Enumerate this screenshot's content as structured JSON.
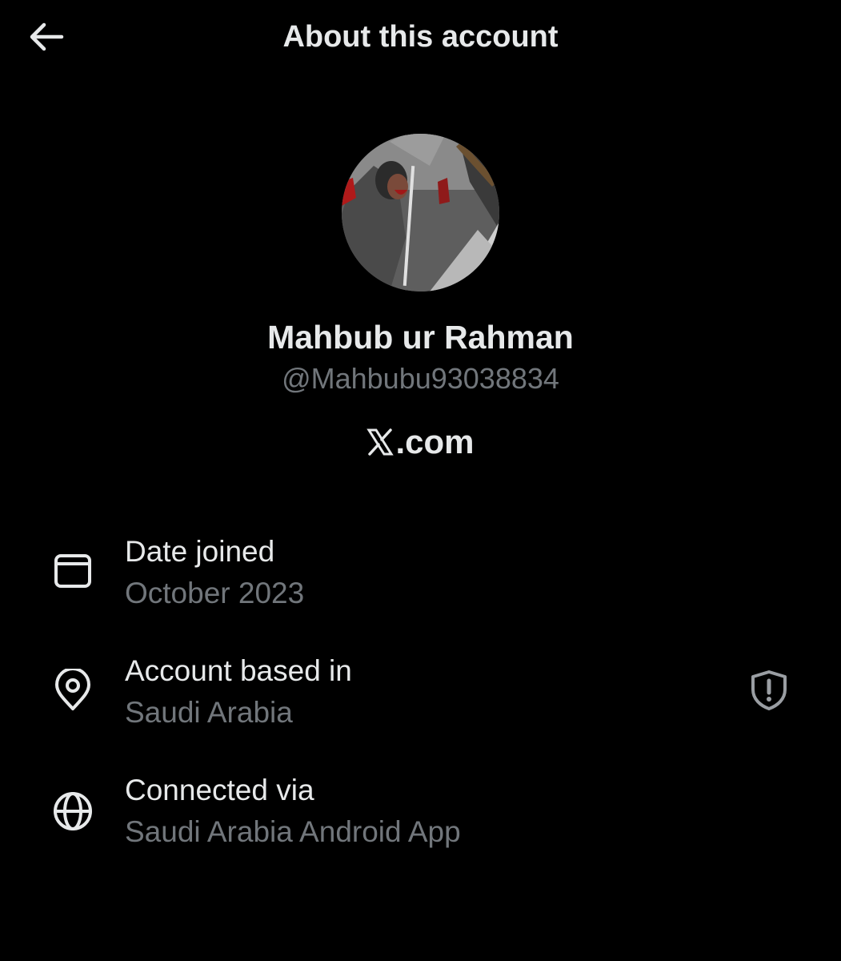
{
  "header": {
    "title": "About this account",
    "back_icon": "arrow-left-icon"
  },
  "profile": {
    "display_name": "Mahbub ur Rahman",
    "handle": "@Mahbubu93038834",
    "avatar_icon": "profile-photo"
  },
  "platform": {
    "logo_icon": "x-logo-icon",
    "label": ".com"
  },
  "rows": [
    {
      "icon": "calendar-icon",
      "label": "Date joined",
      "value": "October 2023"
    },
    {
      "icon": "location-pin-icon",
      "label": "Account based in",
      "value": "Saudi Arabia",
      "badge_icon": "shield-alert-icon"
    },
    {
      "icon": "globe-icon",
      "label": "Connected via",
      "value": "Saudi Arabia Android App"
    }
  ],
  "colors": {
    "background": "#000000",
    "primary_text": "#e7e9ea",
    "secondary_text": "#71767b"
  }
}
